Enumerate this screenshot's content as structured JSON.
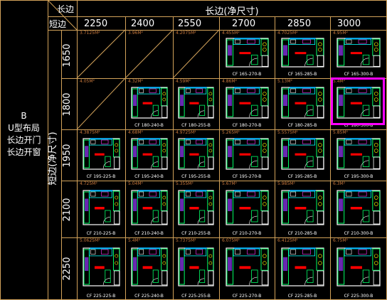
{
  "corner": {
    "long_label": "长边",
    "short_label": "短边"
  },
  "left_block": {
    "line1": "B",
    "line2": "U型布局",
    "line3": "长边开门",
    "line4": "长边开窗"
  },
  "col_header": "长边(净尺寸)",
  "row_header": "短边(净尺寸)",
  "columns": [
    "2250",
    "2400",
    "2550",
    "2700",
    "2850",
    "3000"
  ],
  "rows": [
    "1650",
    "1800",
    "1950",
    "2100",
    "2250"
  ],
  "cells": [
    [
      {
        "area": "3.7125M²",
        "code": ""
      },
      {
        "area": "3.96M²",
        "code": ""
      },
      {
        "area": "4.2075M²",
        "code": ""
      },
      {
        "area": "4.455M²",
        "code": "CF 165-270-B"
      },
      {
        "area": "4.7025M²",
        "code": "CF 165-285-B"
      },
      {
        "area": "4.95M²",
        "code": "CF 165-300-B"
      }
    ],
    [
      {
        "area": "4.05M²",
        "code": ""
      },
      {
        "area": "4.32M²",
        "code": "CF 180-240-B"
      },
      {
        "area": "4.59M²",
        "code": "CF 180-255-B"
      },
      {
        "area": "4.86M²",
        "code": "CF 180-270-B"
      },
      {
        "area": "5.13M²",
        "code": "CF 180-285-B"
      },
      {
        "area": "5.4M²",
        "code": "CF 180-300-B"
      }
    ],
    [
      {
        "area": "4.3875M²",
        "code": "CF 195-225-B"
      },
      {
        "area": "4.68M²",
        "code": "CF 195-240-B"
      },
      {
        "area": "4.9725M²",
        "code": "CF 195-255-B"
      },
      {
        "area": "5.265M²",
        "code": "CF 195-270-B"
      },
      {
        "area": "5.5575M²",
        "code": "CF 195-285-B"
      },
      {
        "area": "5.85M²",
        "code": "CF 195-300-B"
      }
    ],
    [
      {
        "area": "4.725M²",
        "code": "CF 210-225-B"
      },
      {
        "area": "5.04M²",
        "code": "CF 210-240-B"
      },
      {
        "area": "5.355M²",
        "code": "CF 210-255-B"
      },
      {
        "area": "5.67M²",
        "code": "CF 210-270-B"
      },
      {
        "area": "5.985M²",
        "code": "CF 210-285-B"
      },
      {
        "area": "6.3M²",
        "code": "CF 210-300-B"
      }
    ],
    [
      {
        "area": "5.0625M²",
        "code": "CF 225-225-B"
      },
      {
        "area": "5.4M²",
        "code": "CF 225-240-B"
      },
      {
        "area": "5.7375M²",
        "code": "CF 225-255-B"
      },
      {
        "area": "6.075M²",
        "code": "CF 225-270-B"
      },
      {
        "area": "6.4125M²",
        "code": "CF 225-285-B"
      },
      {
        "area": "6.75M²",
        "code": "CF 225-300-B"
      }
    ]
  ],
  "selected": "CF 180-300-B",
  "colors": {
    "grid": "#d2a25a",
    "highlight": "#ff00ff",
    "accent_red": "#ff0000"
  }
}
